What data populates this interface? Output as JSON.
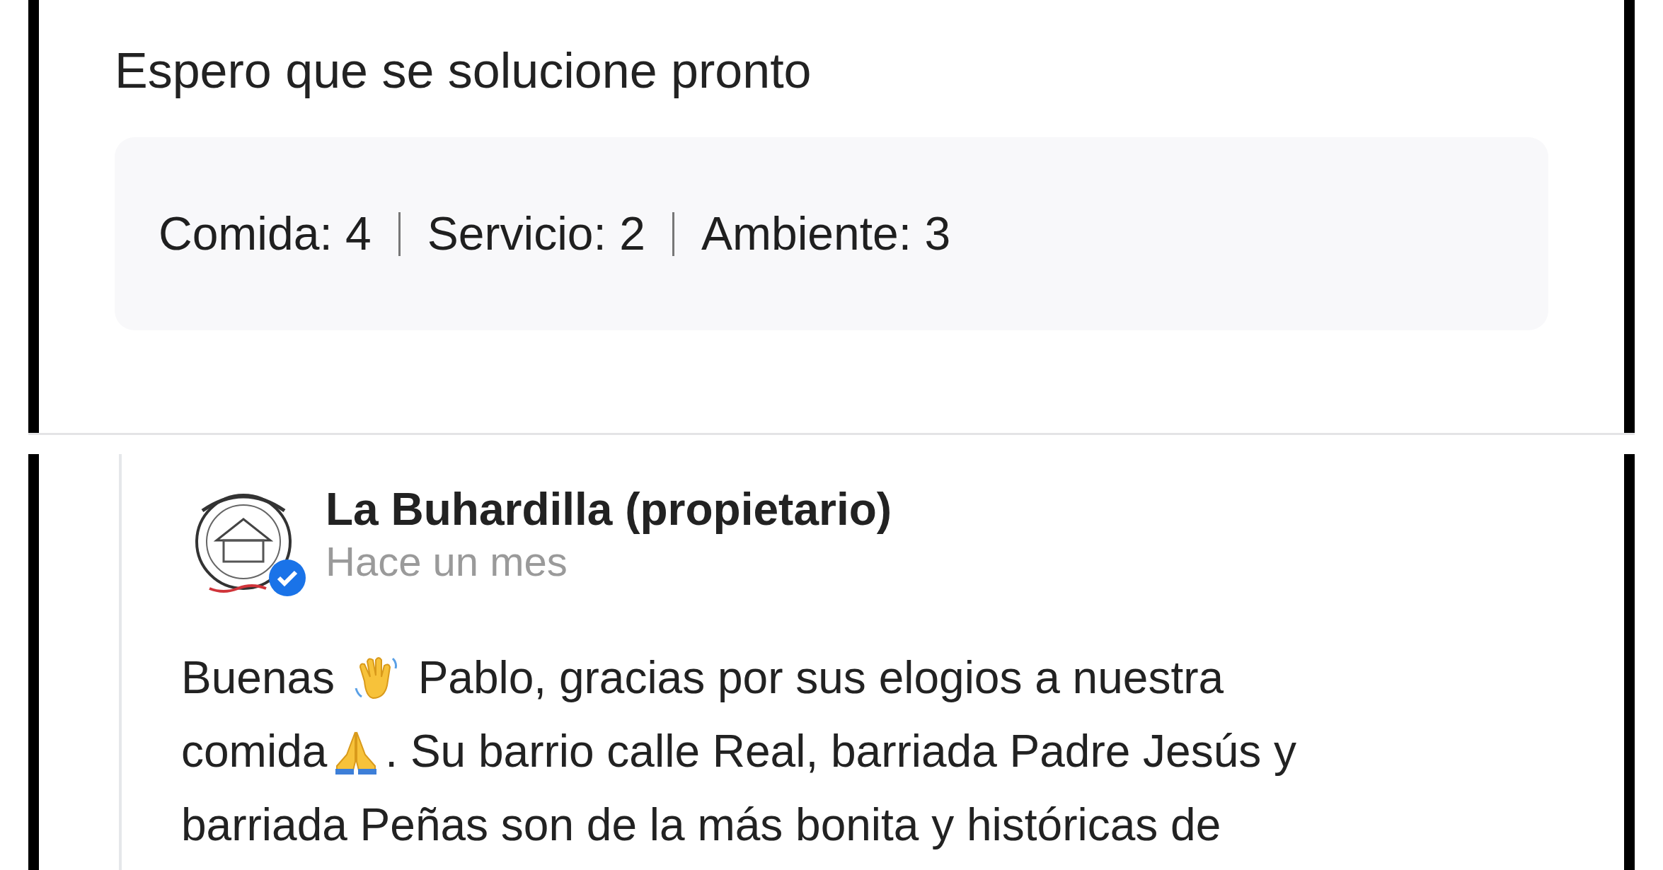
{
  "review": {
    "text": "Espero que se solucione pronto",
    "ratings": [
      "Comida: 4",
      "Servicio: 2",
      "Ambiente: 3"
    ]
  },
  "owner_reply": {
    "author": "La Buhardilla (propietario)",
    "verified": true,
    "time": "Hace un mes",
    "lines": [
      [
        {
          "kind": "text",
          "text": "Buenas "
        },
        {
          "kind": "wave"
        },
        {
          "kind": "text",
          "text": " Pablo, gracias por sus elogios a nuestra"
        }
      ],
      [
        {
          "kind": "text",
          "text": "comida"
        },
        {
          "kind": "pray"
        },
        {
          "kind": "text",
          "text": ". Su barrio calle Real, barriada Padre Jesús y"
        }
      ],
      [
        {
          "kind": "text",
          "text": "barriada Peñas son de la más bonita y históricas de"
        }
      ]
    ]
  }
}
